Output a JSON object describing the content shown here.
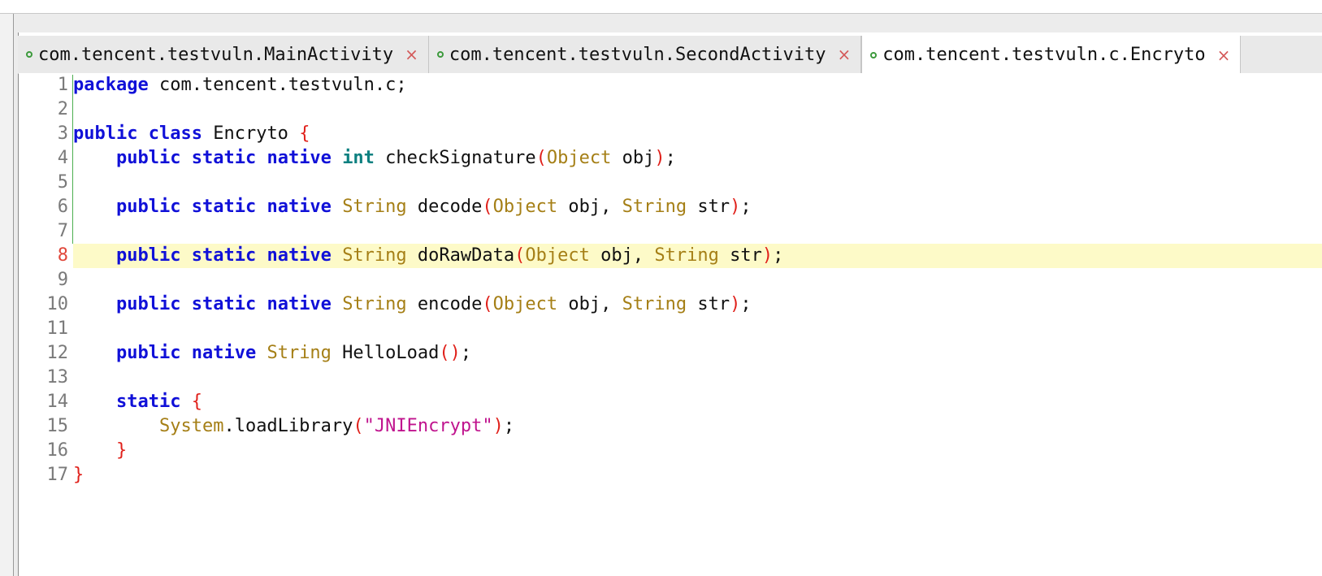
{
  "tabs": [
    {
      "label": "com.tencent.testvuln.MainActivity",
      "active": false
    },
    {
      "label": "com.tencent.testvuln.SecondActivity",
      "active": false
    },
    {
      "label": "com.tencent.testvuln.c.Encryto",
      "active": true
    }
  ],
  "tab_close_glyph": "×",
  "colors": {
    "keyword": "#1010d8",
    "primitive": "#0d8080",
    "type": "#a57f16",
    "bracket": "#e0201a",
    "string": "#c0148e",
    "current_line_highlight": "#fdfac8"
  },
  "editor": {
    "highlighted_line": 8,
    "lines": [
      {
        "n": "1",
        "tokens": [
          {
            "t": "kw",
            "v": "package"
          },
          {
            "t": "p",
            "v": " com.tencent.testvuln.c;"
          }
        ]
      },
      {
        "n": "2",
        "tokens": []
      },
      {
        "n": "3",
        "tokens": [
          {
            "t": "kw",
            "v": "public"
          },
          {
            "t": "p",
            "v": " "
          },
          {
            "t": "kw",
            "v": "class"
          },
          {
            "t": "p",
            "v": " Encryto "
          },
          {
            "t": "br",
            "v": "{"
          }
        ]
      },
      {
        "n": "4",
        "tokens": [
          {
            "t": "p",
            "v": "    "
          },
          {
            "t": "kw",
            "v": "public"
          },
          {
            "t": "p",
            "v": " "
          },
          {
            "t": "kw",
            "v": "static"
          },
          {
            "t": "p",
            "v": " "
          },
          {
            "t": "kw",
            "v": "native"
          },
          {
            "t": "p",
            "v": " "
          },
          {
            "t": "prim",
            "v": "int"
          },
          {
            "t": "p",
            "v": " checkSignature"
          },
          {
            "t": "br",
            "v": "("
          },
          {
            "t": "typ",
            "v": "Object"
          },
          {
            "t": "p",
            "v": " obj"
          },
          {
            "t": "br",
            "v": ")"
          },
          {
            "t": "p",
            "v": ";"
          }
        ]
      },
      {
        "n": "5",
        "tokens": []
      },
      {
        "n": "6",
        "tokens": [
          {
            "t": "p",
            "v": "    "
          },
          {
            "t": "kw",
            "v": "public"
          },
          {
            "t": "p",
            "v": " "
          },
          {
            "t": "kw",
            "v": "static"
          },
          {
            "t": "p",
            "v": " "
          },
          {
            "t": "kw",
            "v": "native"
          },
          {
            "t": "p",
            "v": " "
          },
          {
            "t": "typ",
            "v": "String"
          },
          {
            "t": "p",
            "v": " decode"
          },
          {
            "t": "br",
            "v": "("
          },
          {
            "t": "typ",
            "v": "Object"
          },
          {
            "t": "p",
            "v": " obj, "
          },
          {
            "t": "typ",
            "v": "String"
          },
          {
            "t": "p",
            "v": " str"
          },
          {
            "t": "br",
            "v": ")"
          },
          {
            "t": "p",
            "v": ";"
          }
        ]
      },
      {
        "n": "7",
        "tokens": []
      },
      {
        "n": "8",
        "tokens": [
          {
            "t": "p",
            "v": "    "
          },
          {
            "t": "kw",
            "v": "public"
          },
          {
            "t": "p",
            "v": " "
          },
          {
            "t": "kw",
            "v": "static"
          },
          {
            "t": "p",
            "v": " "
          },
          {
            "t": "kw",
            "v": "native"
          },
          {
            "t": "p",
            "v": " "
          },
          {
            "t": "typ",
            "v": "String"
          },
          {
            "t": "p",
            "v": " doRawData"
          },
          {
            "t": "br",
            "v": "("
          },
          {
            "t": "typ",
            "v": "Object"
          },
          {
            "t": "p",
            "v": " obj, "
          },
          {
            "t": "typ",
            "v": "String"
          },
          {
            "t": "p",
            "v": " str"
          },
          {
            "t": "br",
            "v": ")"
          },
          {
            "t": "p",
            "v": ";"
          }
        ]
      },
      {
        "n": "9",
        "tokens": []
      },
      {
        "n": "10",
        "tokens": [
          {
            "t": "p",
            "v": "    "
          },
          {
            "t": "kw",
            "v": "public"
          },
          {
            "t": "p",
            "v": " "
          },
          {
            "t": "kw",
            "v": "static"
          },
          {
            "t": "p",
            "v": " "
          },
          {
            "t": "kw",
            "v": "native"
          },
          {
            "t": "p",
            "v": " "
          },
          {
            "t": "typ",
            "v": "String"
          },
          {
            "t": "p",
            "v": " encode"
          },
          {
            "t": "br",
            "v": "("
          },
          {
            "t": "typ",
            "v": "Object"
          },
          {
            "t": "p",
            "v": " obj, "
          },
          {
            "t": "typ",
            "v": "String"
          },
          {
            "t": "p",
            "v": " str"
          },
          {
            "t": "br",
            "v": ")"
          },
          {
            "t": "p",
            "v": ";"
          }
        ]
      },
      {
        "n": "11",
        "tokens": []
      },
      {
        "n": "12",
        "tokens": [
          {
            "t": "p",
            "v": "    "
          },
          {
            "t": "kw",
            "v": "public"
          },
          {
            "t": "p",
            "v": " "
          },
          {
            "t": "kw",
            "v": "native"
          },
          {
            "t": "p",
            "v": " "
          },
          {
            "t": "typ",
            "v": "String"
          },
          {
            "t": "p",
            "v": " HelloLoad"
          },
          {
            "t": "br",
            "v": "()"
          },
          {
            "t": "p",
            "v": ";"
          }
        ]
      },
      {
        "n": "13",
        "tokens": []
      },
      {
        "n": "14",
        "tokens": [
          {
            "t": "p",
            "v": "    "
          },
          {
            "t": "kw",
            "v": "static"
          },
          {
            "t": "p",
            "v": " "
          },
          {
            "t": "br",
            "v": "{"
          }
        ]
      },
      {
        "n": "15",
        "tokens": [
          {
            "t": "p",
            "v": "        "
          },
          {
            "t": "typ",
            "v": "System"
          },
          {
            "t": "p",
            "v": ".loadLibrary"
          },
          {
            "t": "br",
            "v": "("
          },
          {
            "t": "str",
            "v": "\"JNIEncrypt\""
          },
          {
            "t": "br",
            "v": ")"
          },
          {
            "t": "p",
            "v": ";"
          }
        ]
      },
      {
        "n": "16",
        "tokens": [
          {
            "t": "p",
            "v": "    "
          },
          {
            "t": "br",
            "v": "}"
          }
        ]
      },
      {
        "n": "17",
        "tokens": [
          {
            "t": "br",
            "v": "}"
          }
        ]
      }
    ]
  }
}
